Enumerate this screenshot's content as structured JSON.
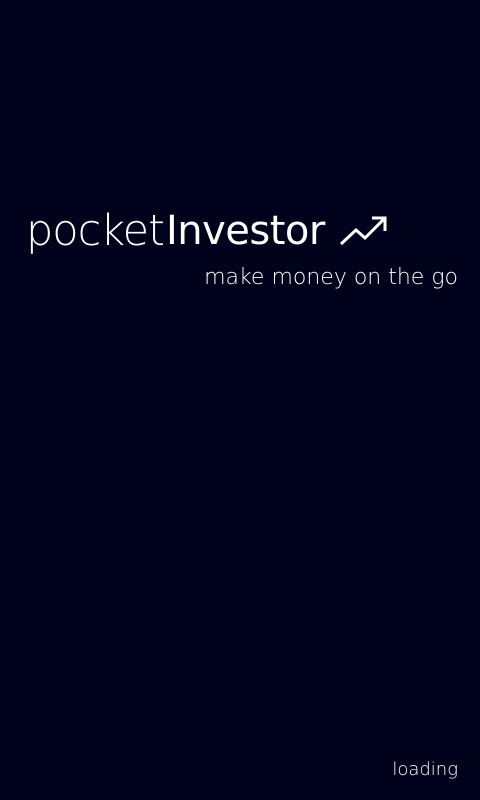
{
  "splash": {
    "logo_part1": "pocket",
    "logo_part2": "Investor",
    "logo_icon": "trend-up-arrow-icon",
    "tagline": "make money on the go",
    "status": "loading"
  },
  "colors": {
    "background": "#01031c",
    "text": "#ffffff"
  }
}
